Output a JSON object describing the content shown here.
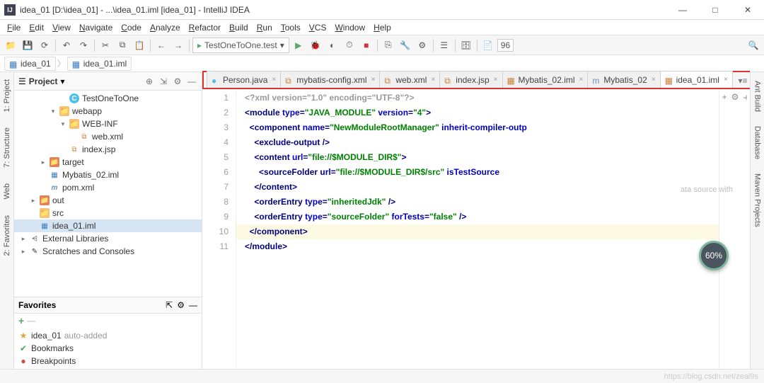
{
  "title": "idea_01 [D:\\idea_01] - ...\\idea_01.iml [idea_01] - IntelliJ IDEA",
  "menus": [
    "File",
    "Edit",
    "View",
    "Navigate",
    "Code",
    "Analyze",
    "Refactor",
    "Build",
    "Run",
    "Tools",
    "VCS",
    "Window",
    "Help"
  ],
  "run_config": "TestOneToOne.test",
  "run_badge": "96",
  "breadcrumbs": [
    {
      "label": "idea_01",
      "icon": "module"
    },
    {
      "label": "idea_01.iml",
      "icon": "module"
    }
  ],
  "project_panel": {
    "title": "Project"
  },
  "tree": [
    {
      "indent": 4,
      "twist": "",
      "icon": "class",
      "label": "TestOneToOne"
    },
    {
      "indent": 3,
      "twist": "v",
      "icon": "folder",
      "label": "webapp"
    },
    {
      "indent": 4,
      "twist": "v",
      "icon": "folder",
      "label": "WEB-INF"
    },
    {
      "indent": 5,
      "twist": "",
      "icon": "xml",
      "label": "web.xml"
    },
    {
      "indent": 4,
      "twist": "",
      "icon": "xml",
      "label": "index.jsp"
    },
    {
      "indent": 2,
      "twist": ">",
      "icon": "folder-red",
      "label": "target"
    },
    {
      "indent": 2,
      "twist": "",
      "icon": "module",
      "label": "Mybatis_02.iml"
    },
    {
      "indent": 2,
      "twist": "",
      "icon": "maven",
      "label": "pom.xml"
    },
    {
      "indent": 1,
      "twist": ">",
      "icon": "folder-red",
      "label": "out"
    },
    {
      "indent": 1,
      "twist": "",
      "icon": "folder",
      "label": "src"
    },
    {
      "indent": 1,
      "twist": "",
      "icon": "module",
      "label": "idea_01.iml",
      "selected": true
    },
    {
      "indent": 0,
      "twist": ">",
      "icon": "lib",
      "label": "External Libraries"
    },
    {
      "indent": 0,
      "twist": ">",
      "icon": "scratch",
      "label": "Scratches and Consoles"
    }
  ],
  "favorites": {
    "title": "Favorites",
    "items": [
      {
        "icon": "star",
        "label": "idea_01",
        "suffix": "auto-added"
      },
      {
        "icon": "bm",
        "label": "Bookmarks"
      },
      {
        "icon": "bp",
        "label": "Breakpoints"
      }
    ]
  },
  "left_tabs": [
    "1: Project",
    "7: Structure",
    "Web",
    "2: Favorites"
  ],
  "right_tabs": [
    "Ant Build",
    "Database",
    "Maven Projects"
  ],
  "editor_tabs": [
    {
      "icon": "class",
      "label": "Person.java"
    },
    {
      "icon": "xml",
      "label": "mybatis-config.xml"
    },
    {
      "icon": "xml",
      "label": "web.xml"
    },
    {
      "icon": "xml",
      "label": "index.jsp"
    },
    {
      "icon": "module",
      "label": "Mybatis_02.iml"
    },
    {
      "icon": "maven",
      "label": "Mybatis_02"
    },
    {
      "icon": "module",
      "label": "idea_01.iml",
      "active": true
    }
  ],
  "line_numbers": [
    "1",
    "2",
    "3",
    "4",
    "5",
    "6",
    "7",
    "8",
    "9",
    "10",
    "11"
  ],
  "code_lines": [
    {
      "hl": false,
      "html": "<span class='gray'>&lt;?xml version=\"1.0\" encoding=\"UTF-8\"?&gt;</span>"
    },
    {
      "hl": false,
      "html": "<span class='punc'>&lt;</span><span class='tag'>module</span> <span class='attr'>type</span><span class='punc'>=</span><span class='str'>\"JAVA_MODULE\"</span> <span class='attr'>version</span><span class='punc'>=</span><span class='str'>\"4\"</span><span class='punc'>&gt;</span>"
    },
    {
      "hl": false,
      "html": "  <span class='punc'>&lt;</span><span class='tag'>component</span> <span class='attr'>name</span><span class='punc'>=</span><span class='str'>\"NewModuleRootManager\"</span> <span class='attr'>inherit-compiler-outp</span>"
    },
    {
      "hl": false,
      "html": "    <span class='punc'>&lt;</span><span class='tag'>exclude-output</span> <span class='punc'>/&gt;</span>"
    },
    {
      "hl": false,
      "html": "    <span class='punc'>&lt;</span><span class='tag'>content</span> <span class='attr'>url</span><span class='punc'>=</span><span class='str'>\"file://$MODULE_DIR$\"</span><span class='punc'>&gt;</span>"
    },
    {
      "hl": false,
      "html": "      <span class='punc'>&lt;</span><span class='tag'>sourceFolder</span> <span class='attr'>url</span><span class='punc'>=</span><span class='str'>\"file://$MODULE_DIR$/src\"</span> <span class='attr'>isTestSource</span>"
    },
    {
      "hl": false,
      "html": "    <span class='punc'>&lt;/</span><span class='tag'>content</span><span class='punc'>&gt;</span>"
    },
    {
      "hl": false,
      "html": "    <span class='punc'>&lt;</span><span class='tag'>orderEntry</span> <span class='attr'>type</span><span class='punc'>=</span><span class='str'>\"inheritedJdk\"</span> <span class='punc'>/&gt;</span>"
    },
    {
      "hl": false,
      "html": "    <span class='punc'>&lt;</span><span class='tag'>orderEntry</span> <span class='attr'>type</span><span class='punc'>=</span><span class='str'>\"sourceFolder\"</span> <span class='attr'>forTests</span><span class='punc'>=</span><span class='str'>\"false\"</span> <span class='punc'>/&gt;</span>"
    },
    {
      "hl": true,
      "html": "  <span class='punc'>&lt;/</span><span class='tag'>component</span><span class='punc'>&gt;</span>"
    },
    {
      "hl": false,
      "html": "<span class='punc'>&lt;/</span><span class='tag'>module</span><span class='punc'>&gt;</span>"
    }
  ],
  "meter": "60%",
  "hint": "ata source with",
  "watermark": "https://blog.csdn.net/zeal9s"
}
